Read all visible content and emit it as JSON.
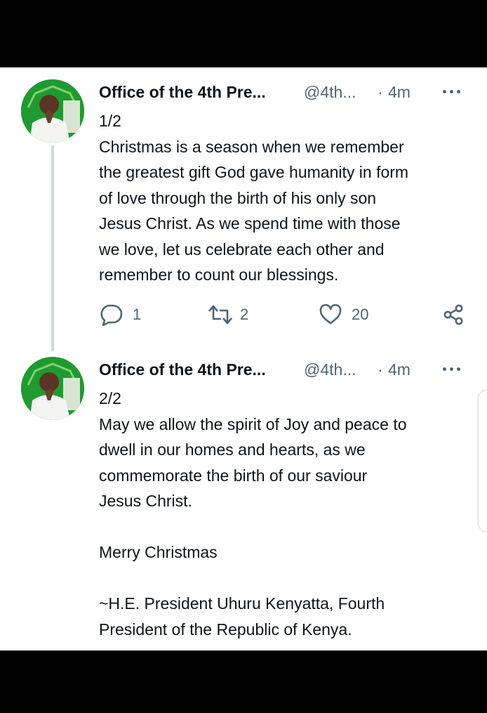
{
  "tweets": [
    {
      "author_name": "Office of the 4th Pre...",
      "handle": "@4th...",
      "separator": "·",
      "time": "4m",
      "text": "1/2\nChristmas is a season when we remember\nthe greatest gift God gave humanity in form\nof love through the birth of his only son\nJesus Christ. As we spend time with those\nwe love, let us celebrate each other and\nremember to count our blessings.",
      "replies": "1",
      "retweets": "2",
      "likes": "20"
    },
    {
      "author_name": "Office of the 4th Pre...",
      "handle": "@4th...",
      "separator": "·",
      "time": "4m",
      "text": "2/2\nMay we allow the spirit of Joy and peace to\ndwell in our homes and hearts, as we\ncommemorate the birth of our saviour\nJesus Christ.\n\nMerry Christmas\n\n~H.E. President Uhuru Kenyatta, Fourth\nPresident of the Republic of Kenya."
    }
  ],
  "icons": {
    "more": "more-horizontal-icon",
    "reply": "reply-bubble-icon",
    "retweet": "retweet-icon",
    "like": "heart-icon",
    "share": "share-icon"
  },
  "colors": {
    "text": "#0f1419",
    "secondary": "#536471",
    "thread_line": "#cfd9de",
    "avatar_bg": "#1f9a31"
  }
}
